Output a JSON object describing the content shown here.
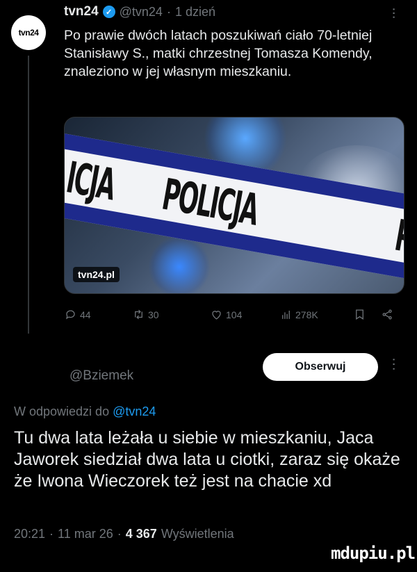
{
  "original_tweet": {
    "avatar_text": "tvn24",
    "name": "tvn24",
    "handle": "@tvn24",
    "separator": "·",
    "time": "1 dzień",
    "more": "⋮",
    "text": "Po prawie dwóch latach poszukiwań ciało 70-letniej Stanisławy S., matki chrzestnej Tomasza Komendy, znaleziono w jej własnym mieszkaniu.",
    "media": {
      "tape_text": "POLICJA",
      "tape_text_left": "ICJA",
      "tape_text_right": "P",
      "source_label": "tvn24.pl"
    },
    "actions": {
      "replies": "44",
      "retweets": "30",
      "likes": "104",
      "views": "278K"
    }
  },
  "reply_tweet": {
    "handle": "@Bziemek",
    "follow_label": "Obserwuj",
    "more": "⋮",
    "in_reply_prefix": "W odpowiedzi do",
    "in_reply_handle": "@tvn24",
    "text": "Tu dwa lata leżała u siebie w mieszkaniu, Jaca Jaworek siedział dwa lata u ciotki, zaraz się okaże że Iwona Wieczorek też jest na chacie xd",
    "time": "20:21",
    "date": "11 mar 26",
    "sep": "·",
    "views_count": "4 367",
    "views_label": "Wyświetlenia"
  },
  "watermark": "mdupiu.pl",
  "colors": {
    "accent": "#1d9bf0",
    "muted": "#71767b",
    "text": "#e7e9ea",
    "bg": "#000000"
  }
}
